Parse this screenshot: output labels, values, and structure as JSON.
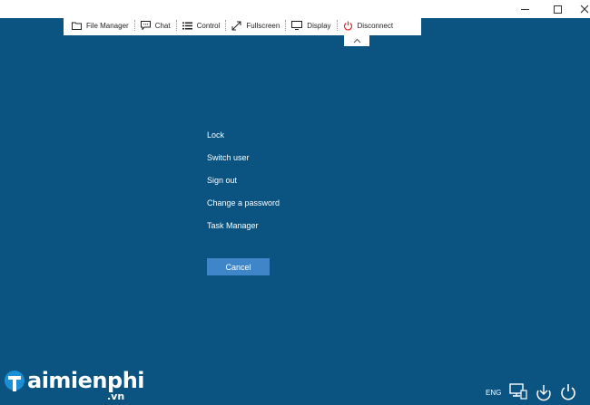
{
  "window": {
    "controls": [
      "minimize-icon",
      "maximize-icon",
      "close-icon"
    ]
  },
  "toolbar": {
    "file_manager": "File Manager",
    "chat": "Chat",
    "control": "Control",
    "fullscreen": "Fullscreen",
    "display": "Display",
    "disconnect": "Disconnect",
    "disconnect_color": "#e02b2b"
  },
  "menu": {
    "items": [
      "Lock",
      "Switch user",
      "Sign out",
      "Change a password",
      "Task Manager"
    ],
    "cancel": "Cancel"
  },
  "tray": {
    "language": "ENG",
    "icons": [
      "network-icon",
      "ease-of-access-icon",
      "power-icon"
    ]
  },
  "watermark": {
    "main": "aimienphi",
    "sub": ".vn"
  },
  "colors": {
    "background": "#0b5381",
    "button": "#3f86c8",
    "toolbar": "#ffffff"
  }
}
